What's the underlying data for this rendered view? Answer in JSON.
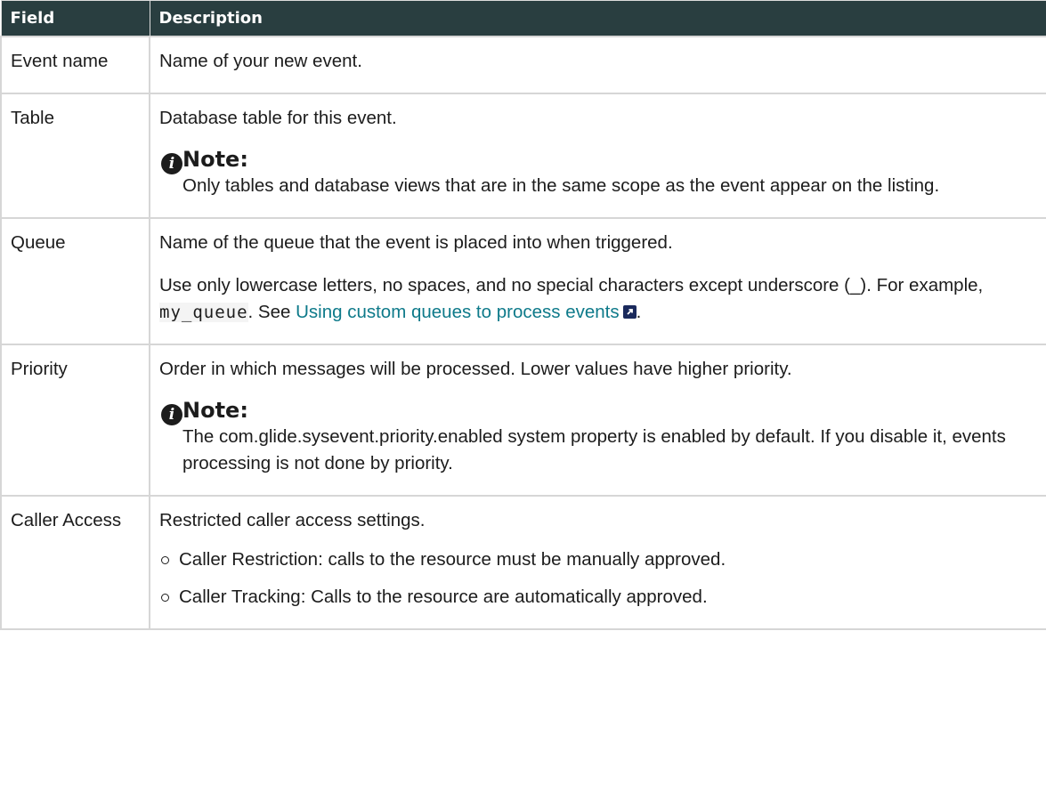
{
  "header": {
    "field": "Field",
    "description": "Description"
  },
  "rows": {
    "event_name": {
      "field": "Event name",
      "desc": "Name of your new event."
    },
    "table": {
      "field": "Table",
      "desc": "Database table for this event.",
      "note_title": "Note:",
      "note_text": "Only tables and database views that are in the same scope as the event appear on the listing."
    },
    "queue": {
      "field": "Queue",
      "desc1": "Name of the queue that the event is placed into when triggered.",
      "desc2_prefix": "Use only lowercase letters, no spaces, and no special characters except underscore (_). For example,",
      "code": "my_queue",
      "desc2_mid": ". See",
      "link": "Using custom queues to process events",
      "desc2_suffix": "."
    },
    "priority": {
      "field": "Priority",
      "desc": "Order in which messages will be processed. Lower values have higher priority.",
      "note_title": "Note:",
      "note_text": "The com.glide.sysevent.priority.enabled system property is enabled by default. If you disable it, events processing is not done by priority."
    },
    "caller_access": {
      "field": "Caller Access",
      "desc": "Restricted caller access settings.",
      "bullets": [
        "Caller Restriction: calls to the resource must be manually approved.",
        "Caller Tracking: Calls to the resource are automatically approved."
      ]
    }
  },
  "icons": {
    "note": "info-icon",
    "external_link": "external-link-icon"
  }
}
